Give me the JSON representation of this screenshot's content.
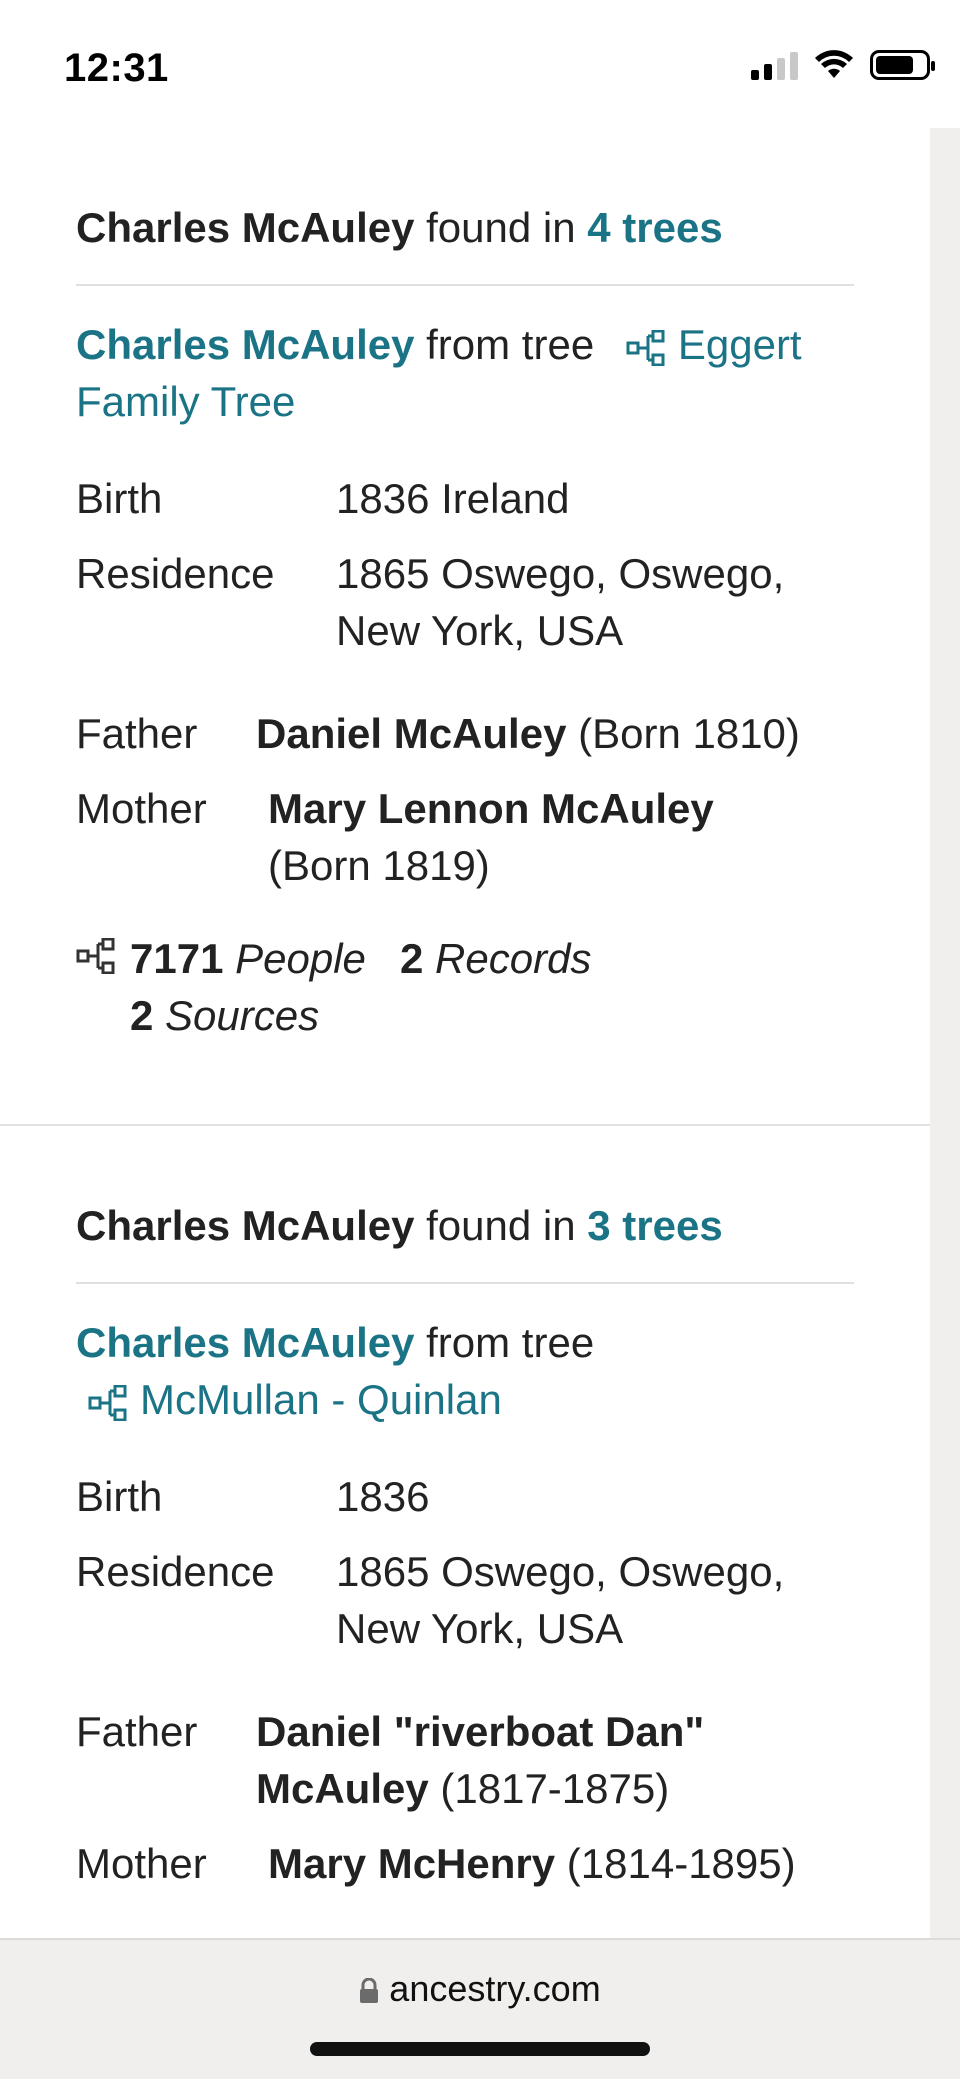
{
  "status": {
    "time": "12:31"
  },
  "cards": [
    {
      "found_name": "Charles McAuley",
      "found_text": "found in",
      "found_count": "4 trees",
      "person_name": "Charles McAuley",
      "from_text": "from tree",
      "tree_name": "Eggert Family Tree",
      "facts": [
        {
          "label": "Birth",
          "value": "1836 Ireland"
        },
        {
          "label": "Residence",
          "value": "1865 Oswego, Oswego, New York, USA"
        }
      ],
      "father": {
        "label": "Father",
        "name": "Daniel McAuley",
        "detail": "(Born 1810)"
      },
      "mother": {
        "label": "Mother",
        "name": "Mary Lennon McAuley",
        "detail": "(Born 1819)"
      },
      "stats": {
        "people_count": "7171",
        "people_label": "People",
        "records_count": "2",
        "records_label": "Records",
        "sources_count": "2",
        "sources_label": "Sources"
      }
    },
    {
      "found_name": "Charles McAuley",
      "found_text": "found in",
      "found_count": "3 trees",
      "person_name": "Charles McAuley",
      "from_text": "from tree",
      "tree_name": "McMullan - Quinlan",
      "facts": [
        {
          "label": "Birth",
          "value": "1836"
        },
        {
          "label": "Residence",
          "value": "1865 Oswego, Oswego, New York, USA"
        }
      ],
      "father": {
        "label": "Father",
        "name": "Daniel \"riverboat Dan\" McAuley",
        "detail": "(1817-1875)"
      },
      "mother": {
        "label": "Mother",
        "name": "Mary McHenry",
        "detail": "(1814-1895)"
      }
    }
  ],
  "browser": {
    "url": "ancestry.com"
  },
  "colors": {
    "accent": "#1b7386",
    "text": "#222222",
    "bar_bg": "#f1efed"
  }
}
